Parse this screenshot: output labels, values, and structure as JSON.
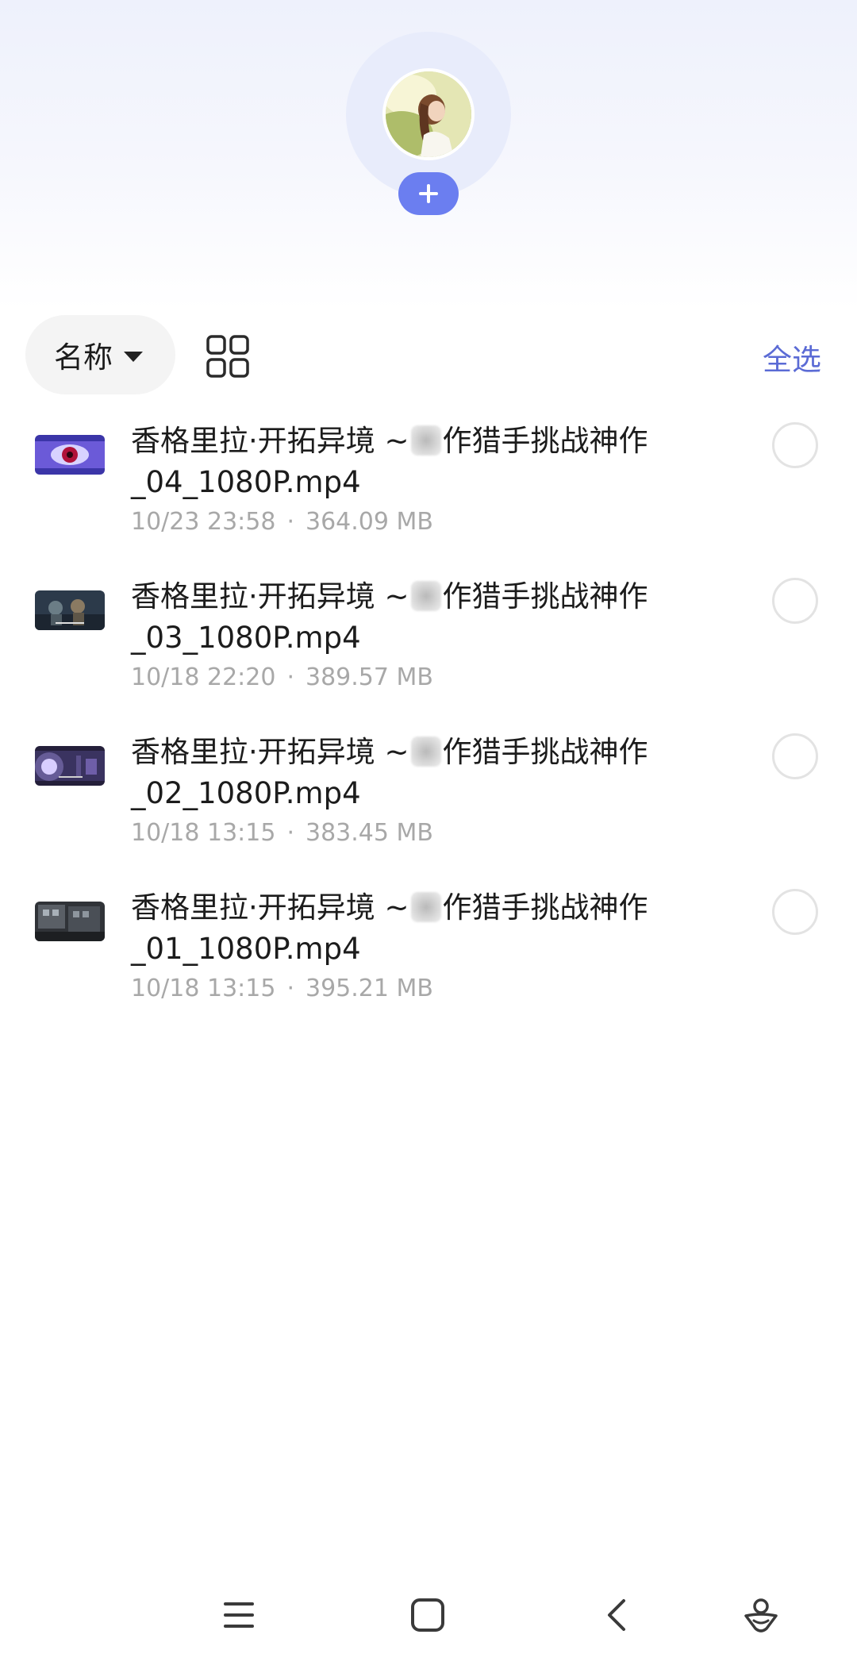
{
  "header": {
    "add_icon": "plus-icon"
  },
  "toolbar": {
    "sort_label": "名称",
    "sort_caret_icon": "caret-down-icon",
    "view_toggle_icon": "grid-view-icon",
    "select_all_label": "全选"
  },
  "files": [
    {
      "name_part1": "香格里拉·开拓异境 ~",
      "name_part2": "作猎手挑战神作\n_04_1080P.mp4",
      "date": "10/23 23:58",
      "separator": "·",
      "size": "364.09 MB",
      "thumb_color": "#3b35a8"
    },
    {
      "name_part1": "香格里拉·开拓异境 ~",
      "name_part2": "作猎手挑战神作\n_03_1080P.mp4",
      "date": "10/18 22:20",
      "separator": "·",
      "size": "389.57 MB",
      "thumb_color": "#2c3a4a"
    },
    {
      "name_part1": "香格里拉·开拓异境 ~",
      "name_part2": "作猎手挑战神作\n_02_1080P.mp4",
      "date": "10/18 13:15",
      "separator": "·",
      "size": "383.45 MB",
      "thumb_color": "#241f3a"
    },
    {
      "name_part1": "香格里拉·开拓异境 ~",
      "name_part2": "作猎手挑战神作\n_01_1080P.mp4",
      "date": "10/18 13:15",
      "separator": "·",
      "size": "395.21 MB",
      "thumb_color": "#303338"
    }
  ],
  "navigation": {
    "menu_icon": "menu-icon",
    "home_icon": "home-square-icon",
    "back_icon": "back-chevron-icon",
    "assistant_icon": "assistant-icon"
  },
  "colors": {
    "accent": "#6b7ef0",
    "select_all": "#5b6bd5",
    "meta_text": "#a8a8a8"
  }
}
